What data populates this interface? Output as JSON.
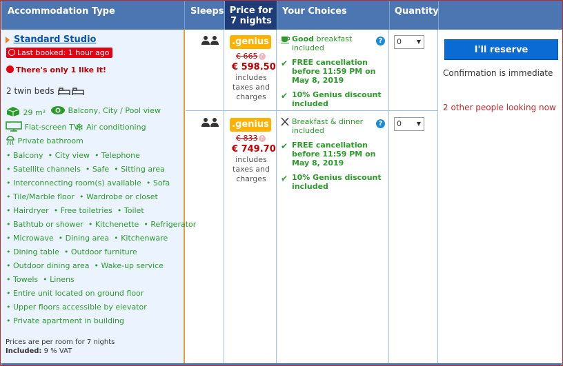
{
  "headers": {
    "accommodation_type": "Accommodation Type",
    "sleeps": "Sleeps",
    "price_line1": "Price for",
    "price_line2": "7 nights",
    "your_choices": "Your Choices",
    "quantity": "Quantity"
  },
  "room": {
    "name": "Standard Studio",
    "last_booked": "Last booked: 1 hour ago",
    "only_left": "There's only 1 like it!",
    "beds": "2 twin beds",
    "size": "29 m²",
    "view": "Balcony, City / Pool view",
    "tv": "Flat-screen TV",
    "ac": "Air conditioning",
    "bathroom": "Private bathroom",
    "facility_lines": [
      [
        "Balcony",
        "City view",
        "Telephone"
      ],
      [
        "Satellite channels",
        "Safe",
        "Sitting area"
      ],
      [
        "Interconnecting room(s) available",
        "Sofa"
      ],
      [
        "Tile/Marble floor",
        "Wardrobe or closet"
      ],
      [
        "Hairdryer",
        "Free toiletries",
        "Toilet"
      ],
      [
        "Bathtub or shower",
        "Kitchenette",
        "Refrigerator"
      ],
      [
        "Microwave",
        "Dining area",
        "Kitchenware"
      ],
      [
        "Dining table",
        "Outdoor furniture"
      ],
      [
        "Outdoor dining area",
        "Wake-up service"
      ],
      [
        "Towels",
        "Linens"
      ],
      [
        "Entire unit located on ground floor"
      ],
      [
        "Upper floors accessible by elevator"
      ],
      [
        "Private apartment in building"
      ]
    ],
    "prices_note": "Prices are per room for 7 nights",
    "included_label": "Included:",
    "included_value": "9 % VAT"
  },
  "options": [
    {
      "genius": ".genius",
      "old_price": "€ 665",
      "new_price": "€ 598.50",
      "incl_lines": [
        "includes",
        "taxes and",
        "charges"
      ],
      "meal_bold": "Good",
      "meal_rest": " breakfast",
      "meal_line2": "included",
      "cancel_lines": [
        "FREE cancellation",
        "before 11:59 PM on",
        "May 8, 2019"
      ],
      "discount_lines": [
        "10% Genius discount",
        "included"
      ],
      "quantity": "0"
    },
    {
      "genius": ".genius",
      "old_price": "€ 833",
      "new_price": "€ 749.70",
      "incl_lines": [
        "includes",
        "taxes and",
        "charges"
      ],
      "meal_bold": "",
      "meal_rest": "Breakfast & dinner",
      "meal_line2": "included",
      "cancel_lines": [
        "FREE cancellation",
        "before 11:59 PM on",
        "May 8, 2019"
      ],
      "discount_lines": [
        "10% Genius discount",
        "included"
      ],
      "quantity": "0"
    }
  ],
  "reserve": {
    "button": "I'll reserve",
    "confirmation": "Confirmation is immediate",
    "looking": "2 other people looking now"
  },
  "colors": {
    "header_bg": "#4b76b2",
    "price_header_bg": "#1e3d78",
    "accent_green": "#2b9a2b",
    "price_red": "#c00000",
    "genius_orange": "#ffb100",
    "reserve_blue": "#0a6bd4"
  }
}
